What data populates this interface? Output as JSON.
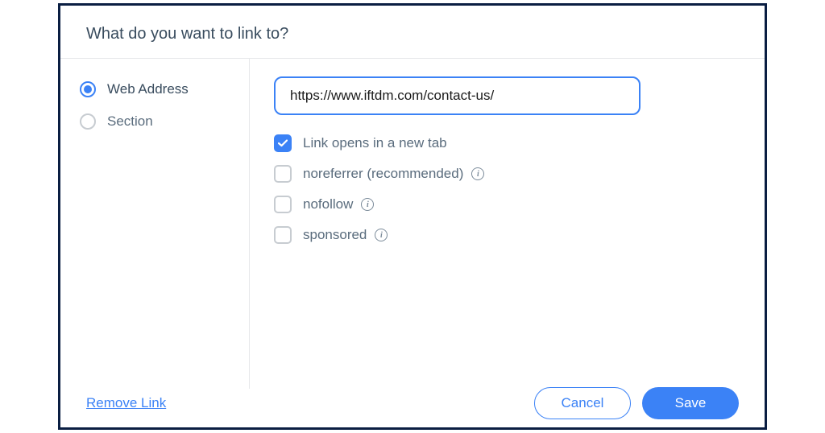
{
  "header": {
    "title": "What do you want to link to?"
  },
  "sidebar": {
    "options": [
      {
        "label": "Web Address",
        "selected": true
      },
      {
        "label": "Section",
        "selected": false
      }
    ]
  },
  "main": {
    "url_value": "https://www.iftdm.com/contact-us/",
    "checkboxes": [
      {
        "label": "Link opens in a new tab",
        "checked": true,
        "has_info": false
      },
      {
        "label": "noreferrer (recommended)",
        "checked": false,
        "has_info": true
      },
      {
        "label": "nofollow",
        "checked": false,
        "has_info": true
      },
      {
        "label": "sponsored",
        "checked": false,
        "has_info": true
      }
    ]
  },
  "footer": {
    "remove_label": "Remove Link",
    "cancel_label": "Cancel",
    "save_label": "Save"
  },
  "icons": {
    "info_glyph": "i"
  }
}
